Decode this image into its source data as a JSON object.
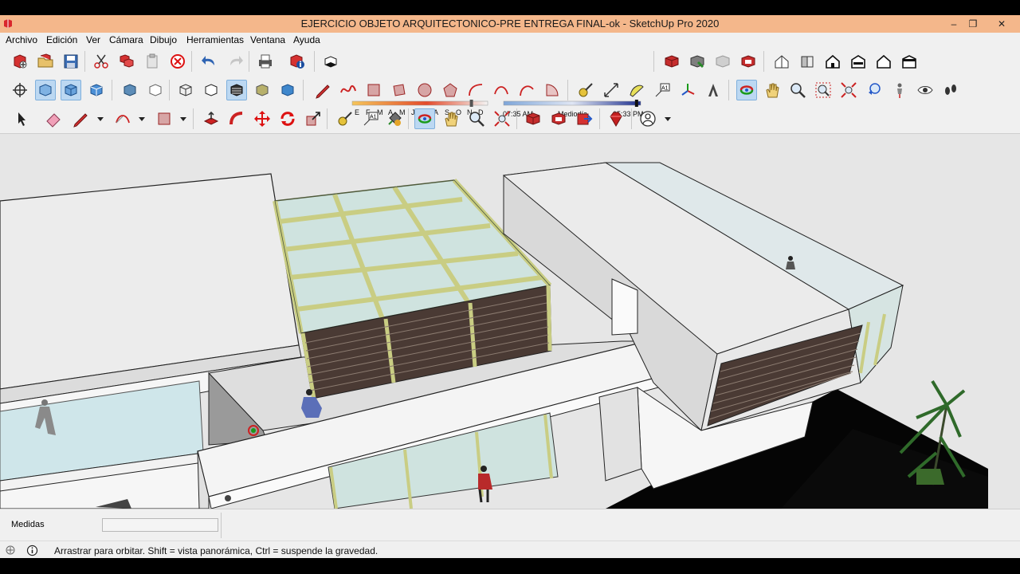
{
  "window": {
    "title": "EJERCICIO OBJETO ARQUITECTONICO-PRE ENTREGA FINAL-ok - SketchUp Pro 2020",
    "minimize": "–",
    "restore": "❐",
    "close": "✕"
  },
  "menu": [
    "Archivo",
    "Edición",
    "Ver",
    "Cámara",
    "Dibujo",
    "Herramientas",
    "Ventana",
    "Ayuda"
  ],
  "shadows": {
    "months": [
      "E",
      "F",
      "M",
      "A",
      "M",
      "J",
      "J",
      "A",
      "S",
      "O",
      "N",
      "D"
    ],
    "time_start": "07:35 AM",
    "time_mid": "Mediodía",
    "time_end": "05:33 PM",
    "month_fraction": 0.88,
    "time_fraction": 0.97
  },
  "status": {
    "measure_label": "Medidas",
    "measure_value": "",
    "hint": "Arrastrar para orbitar. Shift = vista panorámica, Ctrl = suspende la gravedad."
  },
  "colors": {
    "title_bar": "#f4b78b",
    "chrome": "#f0f0f0",
    "sky": "#e6e6e6",
    "glass": "#cfe3df",
    "frame": "#c9cd83",
    "wall": "#f7f7f7",
    "slat": "#4a3a34"
  }
}
